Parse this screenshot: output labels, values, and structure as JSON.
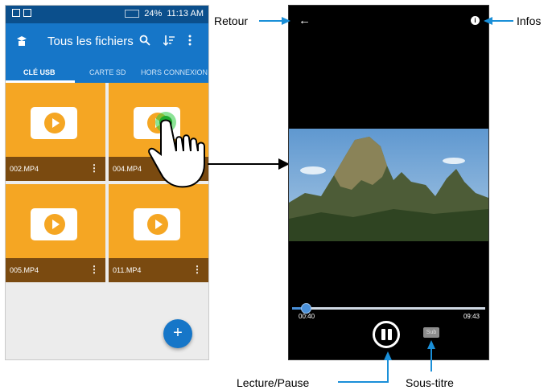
{
  "left_phone": {
    "status_bar": {
      "time": "11:13 AM",
      "battery": "24%"
    },
    "app_bar": {
      "title": "Tous les fichiers",
      "search_icon": "search-icon",
      "sort_icon": "sort-icon",
      "menu_icon": "more-vert-icon"
    },
    "tabs": [
      {
        "label": "CLÉ USB",
        "active": true
      },
      {
        "label": "CARTE SD",
        "active": false
      },
      {
        "label": "HORS CONNEXION",
        "active": false
      }
    ],
    "files": [
      {
        "name": "002.MP4"
      },
      {
        "name": "004.MP4"
      },
      {
        "name": "005.MP4"
      },
      {
        "name": "011.MP4"
      }
    ],
    "fab_label": "+",
    "colors": {
      "app_bar": "#1676c8",
      "tile": "#f5a623",
      "tile_footer": "#7a4a10"
    }
  },
  "right_phone": {
    "back_icon": "back-arrow-icon",
    "info_icon": "info-icon",
    "time_current": "00:40",
    "time_total": "09:43",
    "progress": 0.07,
    "subtitle_badge": "Sub"
  },
  "callouts": {
    "retour": "Retour",
    "infos": "Infos",
    "lecture_pause": "Lecture/Pause",
    "sous_titre": "Sous-titre"
  },
  "callout_color": "#1a8fd8"
}
